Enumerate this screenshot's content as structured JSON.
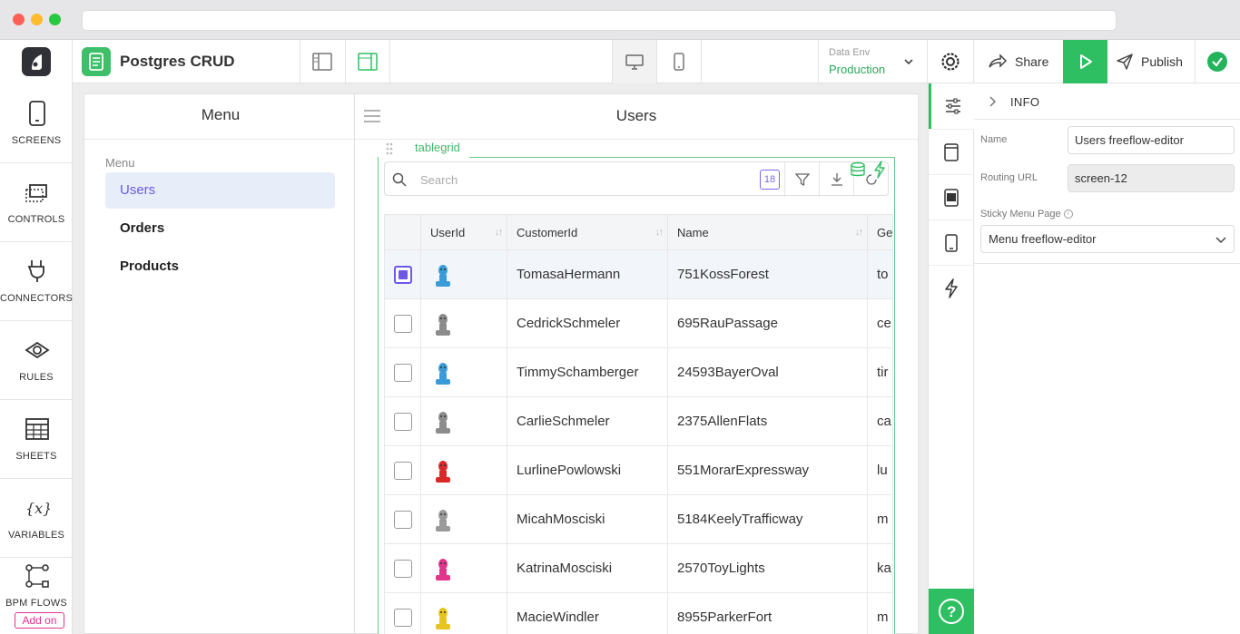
{
  "app": {
    "title": "Postgres CRUD",
    "env_label": "Data Env",
    "env_value": "Production",
    "share_label": "Share",
    "publish_label": "Publish"
  },
  "rail": {
    "items": [
      {
        "label": "SCREENS",
        "icon": "screens-icon"
      },
      {
        "label": "CONTROLS",
        "icon": "controls-icon"
      },
      {
        "label": "CONNECTORS",
        "icon": "plug-icon"
      },
      {
        "label": "RULES",
        "icon": "eye-icon"
      },
      {
        "label": "SHEETS",
        "icon": "sheet-icon"
      },
      {
        "label": "VARIABLES",
        "icon": "variables-icon"
      },
      {
        "label": "BPM FLOWS",
        "icon": "flow-icon"
      }
    ],
    "addon_label": "Add on"
  },
  "menu_panel": {
    "title": "Menu",
    "caption": "Menu",
    "items": [
      {
        "label": "Users",
        "active": true
      },
      {
        "label": "Orders",
        "active": false
      },
      {
        "label": "Products",
        "active": false
      }
    ]
  },
  "users_panel": {
    "title": "Users",
    "tag": "tablegrid",
    "search_placeholder": "Search",
    "count": "18",
    "columns": [
      "UserId",
      "CustomerId",
      "Name",
      "Ge"
    ],
    "rows": [
      {
        "customer": "TomasaHermann",
        "name": "751KossForest",
        "ge": "to",
        "selected": true,
        "avatar_color": "#3a9bd8"
      },
      {
        "customer": "CedrickSchmeler",
        "name": "695RauPassage",
        "ge": "ce",
        "selected": false,
        "avatar_color": "#8c8c8c"
      },
      {
        "customer": "TimmySchamberger",
        "name": "24593BayerOval",
        "ge": "tir",
        "selected": false,
        "avatar_color": "#3a9bd8"
      },
      {
        "customer": "CarlieSchmeler",
        "name": "2375AllenFlats",
        "ge": "ca",
        "selected": false,
        "avatar_color": "#8c8c8c"
      },
      {
        "customer": "LurlinePowlowski",
        "name": "551MorarExpressway",
        "ge": "lu",
        "selected": false,
        "avatar_color": "#d82a2a"
      },
      {
        "customer": "MicahMosciski",
        "name": "5184KeelyTrafficway",
        "ge": "m",
        "selected": false,
        "avatar_color": "#9a9a9a"
      },
      {
        "customer": "KatrinaMosciski",
        "name": "2570ToyLights",
        "ge": "ka",
        "selected": false,
        "avatar_color": "#e0358a"
      },
      {
        "customer": "MacieWindler",
        "name": "8955ParkerFort",
        "ge": "m",
        "selected": false,
        "avatar_color": "#e6c521"
      }
    ]
  },
  "props": {
    "section": "INFO",
    "name_label": "Name",
    "name_value": "Users freeflow-editor",
    "routing_label": "Routing URL",
    "routing_value": "screen-12",
    "sticky_label": "Sticky Menu Page",
    "sticky_value": "Menu freeflow-editor"
  },
  "colors": {
    "accent_green": "#2fbf63",
    "accent_purple": "#6e59e6",
    "addon_pink": "#e2338f"
  }
}
